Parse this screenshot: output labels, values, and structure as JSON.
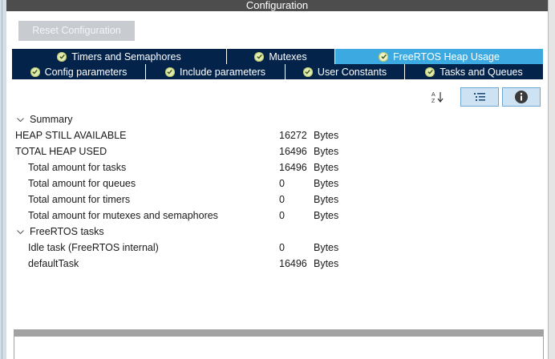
{
  "window": {
    "title": "Configuration"
  },
  "toolbar": {
    "reset_label": "Reset Configuration"
  },
  "tabs": {
    "row1": [
      {
        "label": "Timers and Semaphores",
        "active": false
      },
      {
        "label": "Mutexes",
        "active": false
      },
      {
        "label": "FreeRTOS Heap Usage",
        "active": true
      }
    ],
    "row2": [
      {
        "label": "Config parameters",
        "active": false
      },
      {
        "label": "Include parameters",
        "active": false
      },
      {
        "label": "User Constants",
        "active": false
      },
      {
        "label": "Tasks and Queues",
        "active": false
      }
    ]
  },
  "view_buttons": [
    {
      "icon": "sort-az-icon"
    },
    {
      "icon": "list-view-icon"
    },
    {
      "icon": "info-icon"
    }
  ],
  "summary": {
    "label": "Summary",
    "rows": [
      {
        "label": "HEAP STILL AVAILABLE",
        "value": "16272",
        "unit": "Bytes"
      },
      {
        "label": "TOTAL HEAP USED",
        "value": "16496",
        "unit": "Bytes"
      },
      {
        "label": "Total amount for tasks",
        "value": "16496",
        "unit": "Bytes"
      },
      {
        "label": "Total amount for queues",
        "value": "0",
        "unit": "Bytes"
      },
      {
        "label": "Total amount for timers",
        "value": "0",
        "unit": "Bytes"
      },
      {
        "label": "Total amount for mutexes and semaphores",
        "value": "0",
        "unit": "Bytes"
      }
    ]
  },
  "freertos_tasks": {
    "label": "FreeRTOS tasks",
    "rows": [
      {
        "label": "Idle task (FreeRTOS internal)",
        "value": "0",
        "unit": "Bytes"
      },
      {
        "label": "defaultTask",
        "value": "16496",
        "unit": "Bytes"
      }
    ]
  },
  "colors": {
    "tab_bg": "#03234b",
    "tab_active": "#3caae0",
    "title_bar": "#4d4d4d"
  }
}
